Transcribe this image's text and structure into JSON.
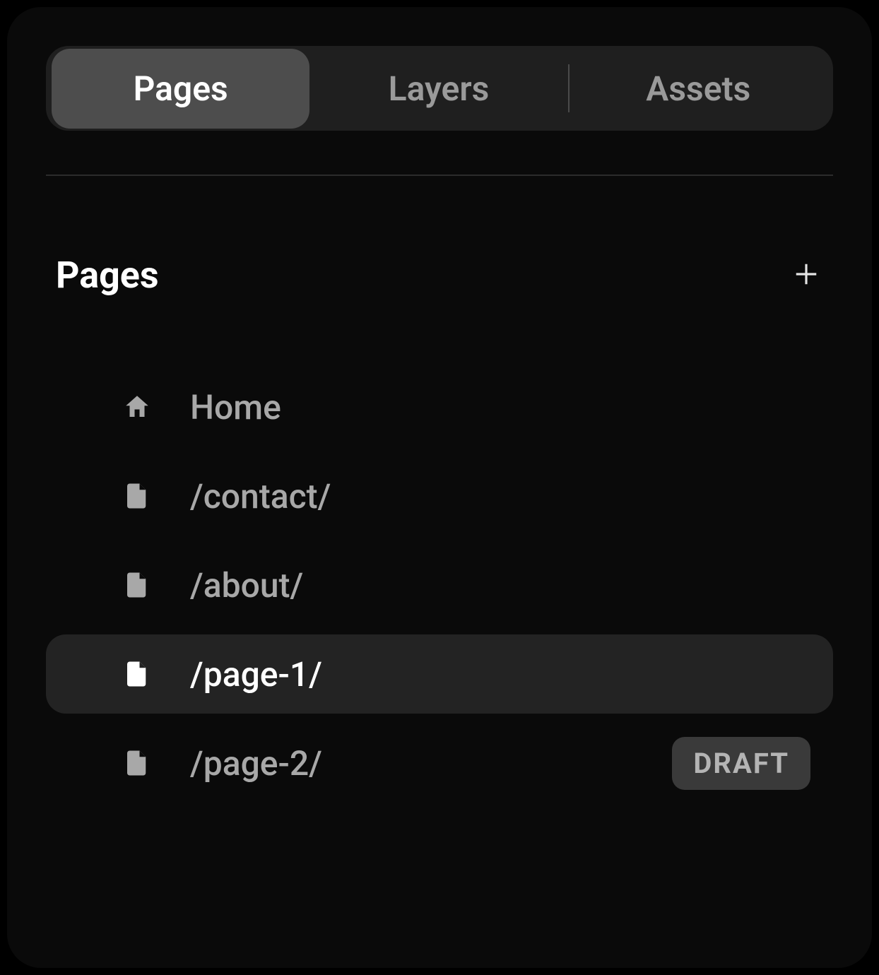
{
  "tabs": {
    "pages": "Pages",
    "layers": "Layers",
    "assets": "Assets",
    "active": "pages"
  },
  "section": {
    "title": "Pages"
  },
  "pages": [
    {
      "label": "Home",
      "icon": "home",
      "selected": false,
      "badge": null
    },
    {
      "label": "/contact/",
      "icon": "file",
      "selected": false,
      "badge": null
    },
    {
      "label": "/about/",
      "icon": "file",
      "selected": false,
      "badge": null
    },
    {
      "label": "/page-1/",
      "icon": "file",
      "selected": true,
      "badge": null
    },
    {
      "label": "/page-2/",
      "icon": "file",
      "selected": false,
      "badge": "DRAFT"
    }
  ]
}
